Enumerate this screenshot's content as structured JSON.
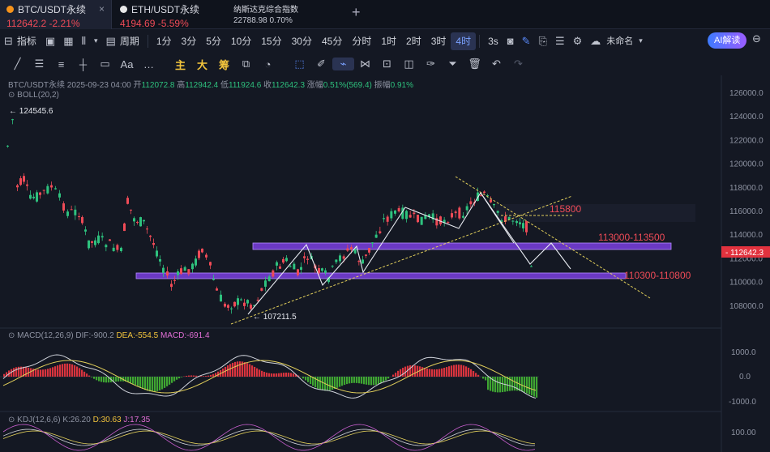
{
  "tabs": [
    {
      "symbol": "BTC/USDT永续",
      "price": "112642.2",
      "change": "-2.21%",
      "close": "×"
    },
    {
      "symbol": "ETH/USDT永续",
      "price": "4194.69",
      "change": "-5.59%"
    },
    {
      "symbol": "纳斯达克综合指数",
      "price": "22788.98",
      "change": "0.70%"
    }
  ],
  "tab_add": "+",
  "toolbar": {
    "indicator_label": "指标",
    "period_label": "周期",
    "timeframes": [
      "1分",
      "3分",
      "5分",
      "10分",
      "15分",
      "30分",
      "45分",
      "分时",
      "1时",
      "2时",
      "3时",
      "4时"
    ],
    "active_timeframe": "4时",
    "interval": "3s",
    "layout_name": "未命名",
    "ai_label": "AI解读"
  },
  "drawing_tools": {
    "main": "主",
    "big": "大",
    "chou": "筹"
  },
  "info": {
    "symbol": "BTC/USDT永续",
    "datetime": "2025-09-23 04:00",
    "open_label": "开",
    "open": "112072.8",
    "high_label": "高",
    "high": "112942.4",
    "low_label": "低",
    "low": "111924.6",
    "close_label": "收",
    "close": "112642.3",
    "chg_label": "涨幅",
    "chg": "0.51%(569.4)",
    "amp_label": "振幅",
    "amp": "0.91%"
  },
  "boll_label": "BOLL(20,2)",
  "macd": {
    "label": "MACD(12,26,9)",
    "dif": "DIF:-900.2",
    "dea": "DEA:-554.5",
    "macd": "MACD:-691.4"
  },
  "kdj": {
    "label": "KDJ(12,6,6)",
    "k": "K:26.20",
    "d": "D:30.63",
    "j": "J:17.35"
  },
  "price_axis": [
    "126000.0",
    "124000.0",
    "122000.0",
    "120000.0",
    "118000.0",
    "116000.0",
    "114000.0",
    "112000.0",
    "110000.0",
    "108000.0"
  ],
  "current_price": "112642.3",
  "macd_axis": [
    "1000.0",
    "0.0",
    "-1000.0"
  ],
  "kdj_axis": [
    "100.00"
  ],
  "annotations": {
    "high_label": "124545.6",
    "low_label": "107211.5",
    "resistance": "115800",
    "zone_upper": "113000-113500",
    "zone_lower": "110300-110800"
  },
  "colors": {
    "up": "#ef4b57",
    "down": "#2ec27e",
    "zone": "#7a3fe0",
    "accent": "#5b8cff"
  }
}
